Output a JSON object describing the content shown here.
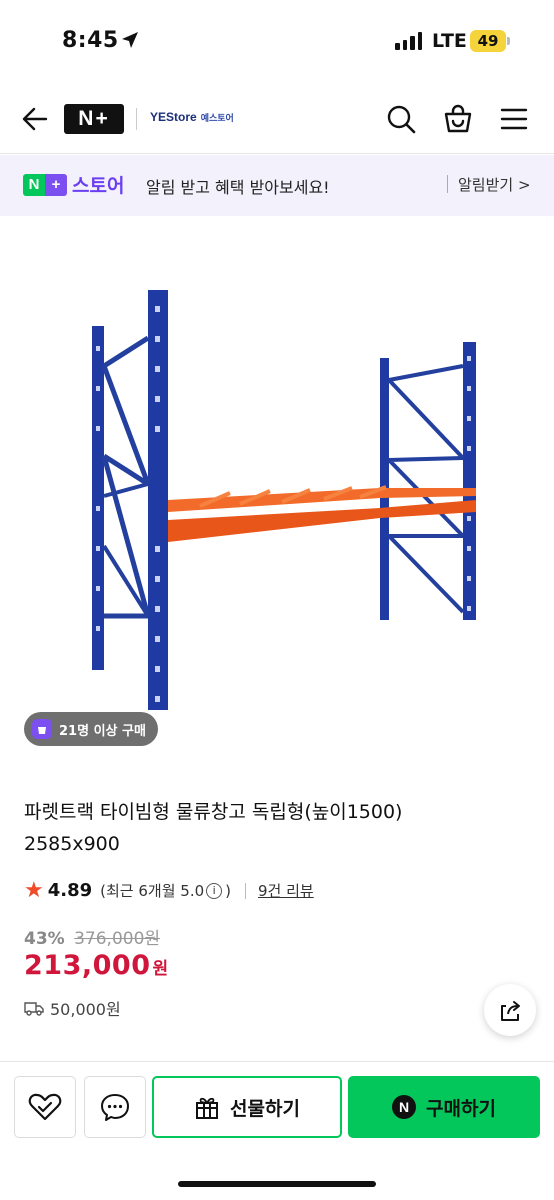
{
  "status_bar": {
    "time": "8:45",
    "network": "LTE",
    "battery": "49"
  },
  "header": {
    "logo": "N+",
    "store_name": "YEStore",
    "store_name_kr": "예스토어"
  },
  "banner": {
    "badge": "N+",
    "store": "스토어",
    "message": "알림 받고 혜택 받아보세요!",
    "action": "알림받기 >"
  },
  "product": {
    "buyers_badge": "21명 이상 구매",
    "title_line1": "파렛트랙 타이빔형 물류창고 독립형(높이1500)",
    "title_line2": "2585x900",
    "rating": "4.89",
    "rating_recent": "(최근 6개월 5.0",
    "rating_close": ")",
    "info_glyph": "i",
    "review_link": "9건 리뷰",
    "discount": "43%",
    "original_price": "376,000원",
    "price": "213,000",
    "price_unit": "원",
    "shipping": "50,000원"
  },
  "bottom_bar": {
    "gift_label": "선물하기",
    "buy_label": "구매하기",
    "buy_badge": "N"
  },
  "colors": {
    "naver_green": "#03c75a",
    "store_purple": "#6b3ef0",
    "price_red": "#d0163b",
    "rack_blue": "#1f3aa3",
    "beam_orange": "#f26b2a"
  },
  "icons": [
    "arrow-left-icon",
    "search-icon",
    "shopping-bag-icon",
    "hamburger-menu-icon",
    "heart-check-icon",
    "chat-bubble-icon",
    "gift-icon",
    "share-icon",
    "truck-icon",
    "shopping-bag-check-icon"
  ]
}
